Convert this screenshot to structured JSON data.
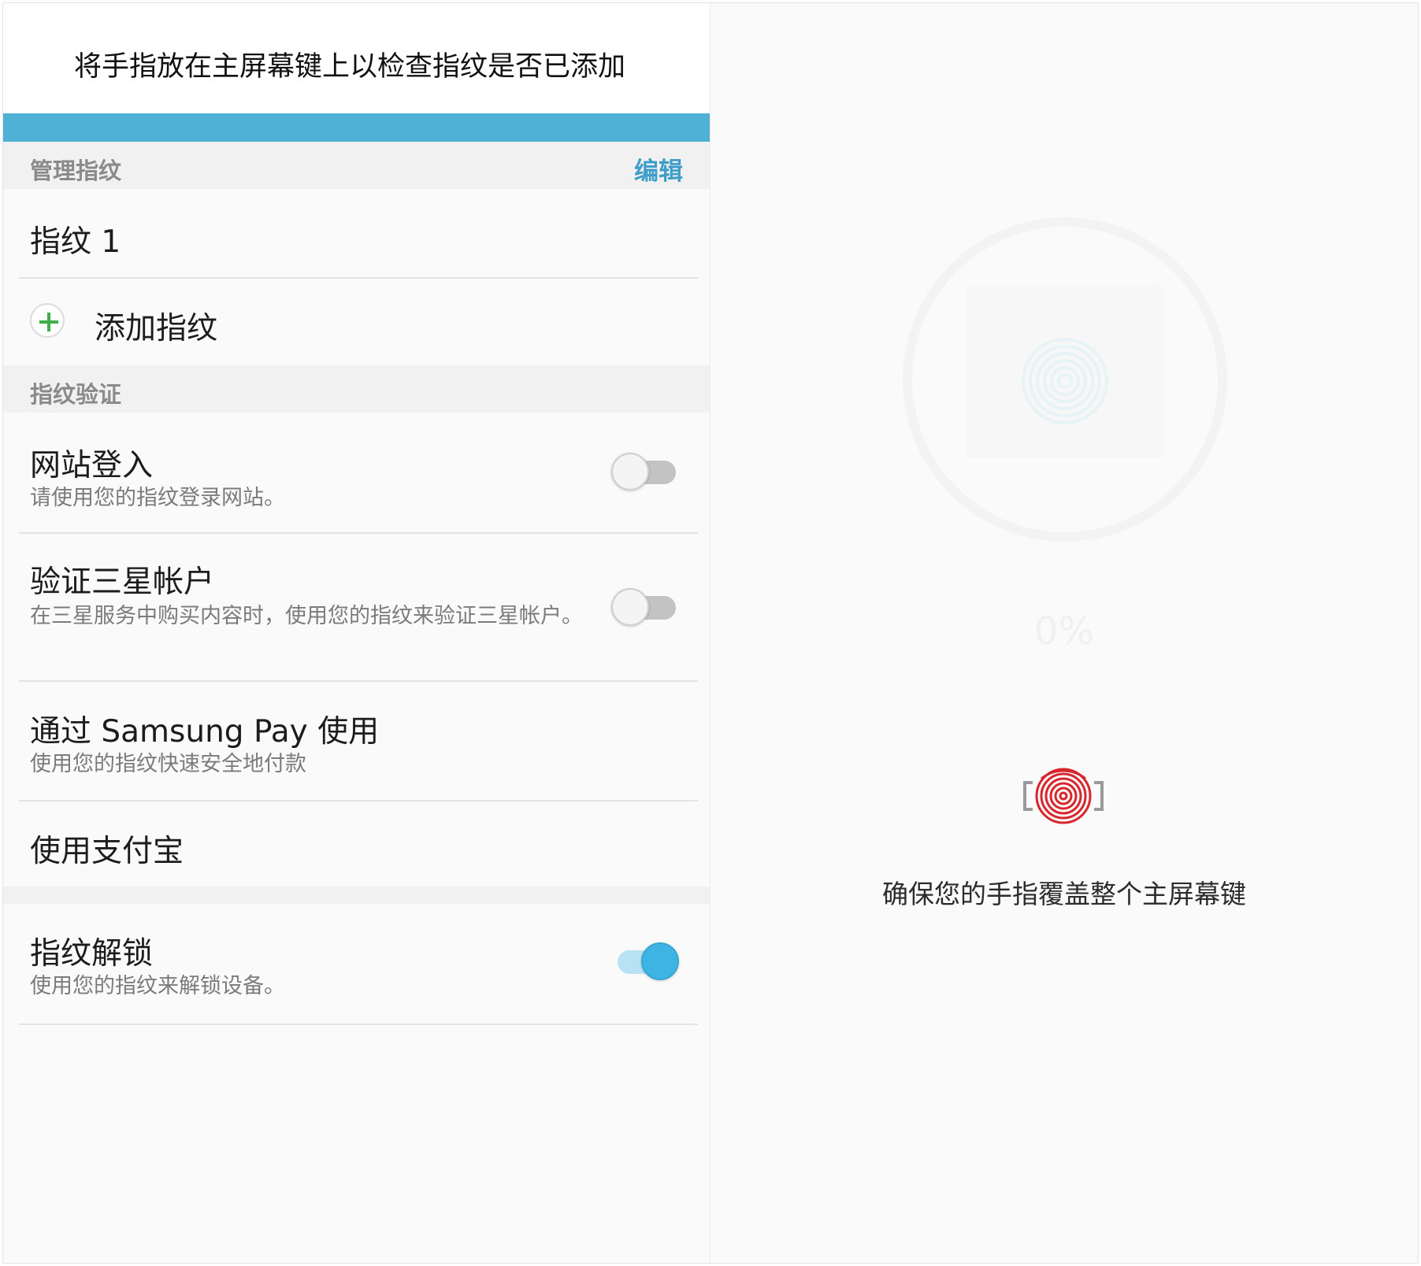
{
  "left": {
    "hint": "将手指放在主屏幕键上以检查指纹是否已添加",
    "manage_section": {
      "title": "管理指纹",
      "action": "编辑"
    },
    "fingerprints": [
      {
        "label": "指纹 1"
      }
    ],
    "add_fingerprint": {
      "label": "添加指纹"
    },
    "verify_section": {
      "title": "指纹验证"
    },
    "web_signin": {
      "title": "网站登入",
      "subtitle": "请使用您的指纹登录网站。",
      "enabled": false
    },
    "samsung_account": {
      "title": "验证三星帐户",
      "subtitle": "在三星服务中购买内容时，使用您的指纹来验证三星帐户。",
      "enabled": false
    },
    "samsung_pay": {
      "title": "通过 Samsung Pay 使用",
      "subtitle": "使用您的指纹快速安全地付款"
    },
    "alipay": {
      "title": "使用支付宝"
    },
    "unlock": {
      "title": "指纹解锁",
      "subtitle": "使用您的指纹来解锁设备。",
      "enabled": true
    }
  },
  "right": {
    "progress_percent": "0%",
    "instruction": "确保您的手指覆盖整个主屏幕键"
  },
  "colors": {
    "accent_blue": "#4fb1d6",
    "edit_blue": "#3f9ec9",
    "toggle_on": "#3eb4e4",
    "plus_green": "#3fae49",
    "fingerprint_red": "#d8262d"
  },
  "icons": {
    "add": "plus-icon",
    "scan": "fingerprint-scan-icon",
    "placeholder": "fingerprint-placeholder-icon"
  }
}
